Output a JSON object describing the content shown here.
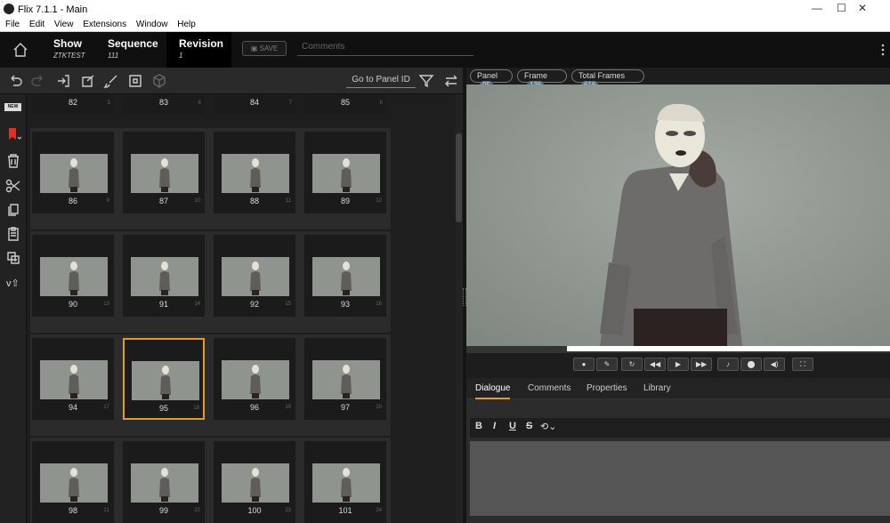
{
  "window": {
    "title": "Flix 7.1.1 - Main"
  },
  "menu": [
    "File",
    "Edit",
    "View",
    "Extensions",
    "Window",
    "Help"
  ],
  "header": {
    "show": {
      "label": "Show",
      "value": "ZTKTEST"
    },
    "sequence": {
      "label": "Sequence",
      "value": "111"
    },
    "revision": {
      "label": "Revision",
      "value": "1"
    },
    "save_label": "SAVE",
    "comments_placeholder": "Comments"
  },
  "toolbar": {
    "goto_label": "Go to Panel ID"
  },
  "badges": {
    "new": "NEW"
  },
  "grid": {
    "top_row": [
      {
        "num": "82",
        "idx": "5"
      },
      {
        "num": "83",
        "idx": "6"
      },
      {
        "num": "84",
        "idx": "7"
      },
      {
        "num": "85",
        "idx": "8"
      }
    ],
    "rows": [
      [
        {
          "num": "86",
          "idx": "9"
        },
        {
          "num": "87",
          "idx": "10"
        },
        {
          "num": "88",
          "idx": "11"
        },
        {
          "num": "89",
          "idx": "12"
        }
      ],
      [
        {
          "num": "90",
          "idx": "13"
        },
        {
          "num": "91",
          "idx": "14"
        },
        {
          "num": "92",
          "idx": "15"
        },
        {
          "num": "93",
          "idx": "16"
        }
      ],
      [
        {
          "num": "94",
          "idx": "17"
        },
        {
          "num": "95",
          "idx": "18",
          "selected": true
        },
        {
          "num": "96",
          "idx": "19"
        },
        {
          "num": "97",
          "idx": "20"
        }
      ],
      [
        {
          "num": "98",
          "idx": "21"
        },
        {
          "num": "99",
          "idx": "22"
        },
        {
          "num": "100",
          "idx": "23"
        },
        {
          "num": "101",
          "idx": "24"
        }
      ]
    ]
  },
  "viewer": {
    "panel": {
      "label": "Panel",
      "value": "95"
    },
    "frame": {
      "label": "Frame",
      "value": "136"
    },
    "total": {
      "label": "Total Frames",
      "value": "616"
    }
  },
  "tabs": {
    "dialogue": "Dialogue",
    "comments": "Comments",
    "properties": "Properties",
    "library": "Library"
  },
  "format": {
    "bold": "B",
    "italic": "I",
    "underline": "U",
    "strike": "S"
  },
  "colors": {
    "accent": "#e29a2a",
    "panel_bg": "#2b2b2b",
    "selected_border": "#e29a2a"
  }
}
